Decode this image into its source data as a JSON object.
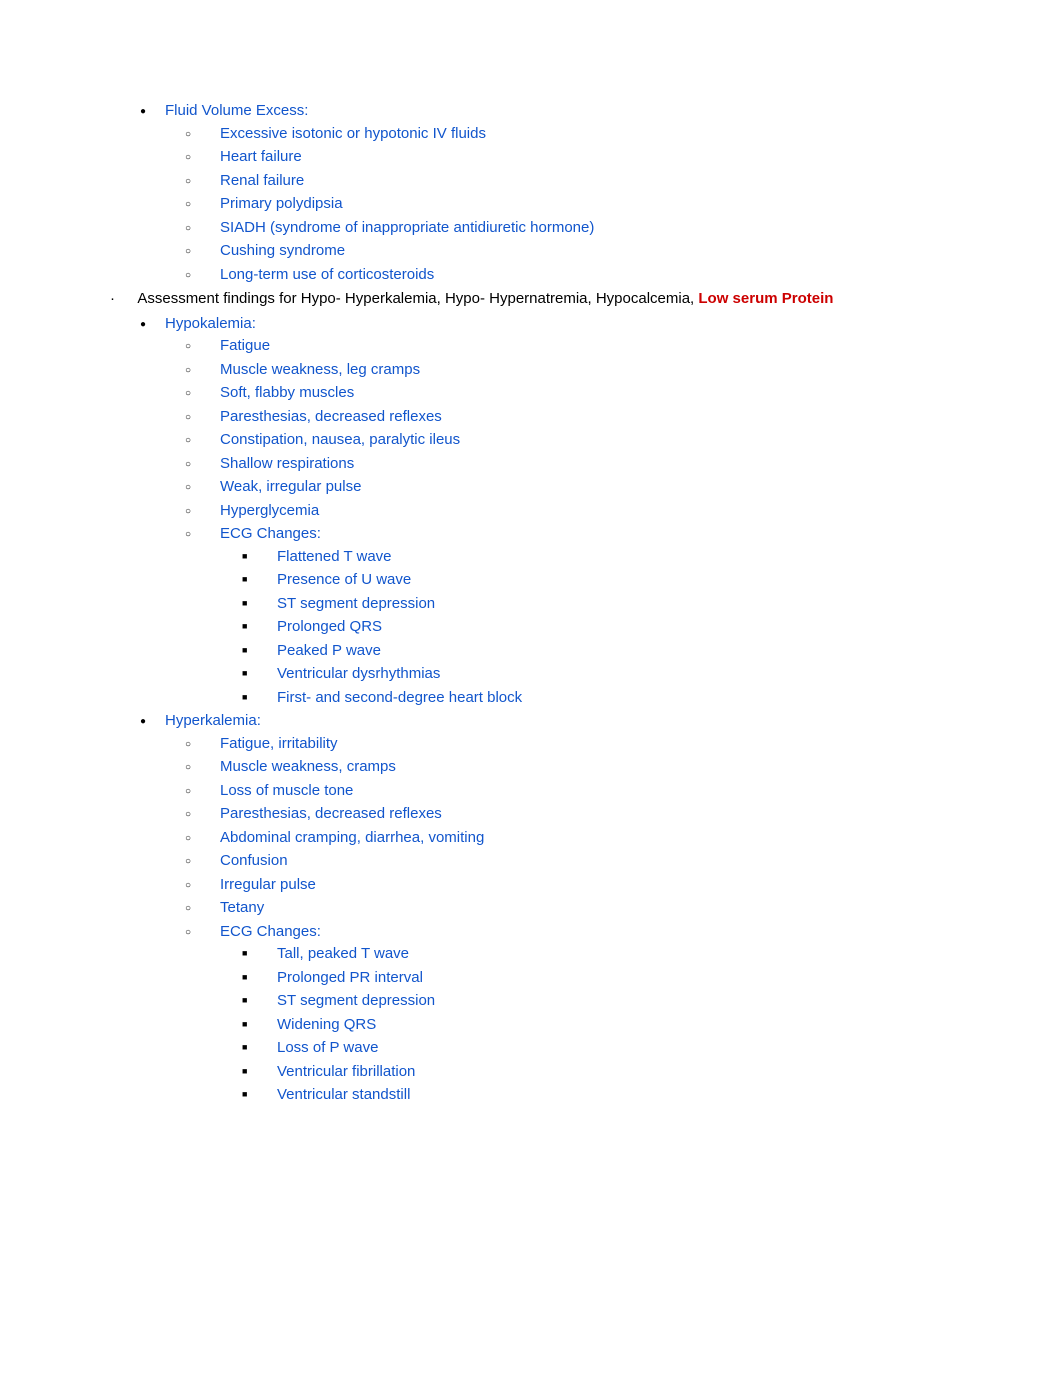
{
  "sections": {
    "fluid_volume_excess": {
      "title": "Fluid Volume Excess:",
      "items": [
        "Excessive isotonic or hypotonic IV fluids",
        "Heart failure",
        "Renal failure",
        "Primary polydipsia",
        "SIADH (syndrome of inappropriate antidiuretic hormone)",
        "Cushing syndrome",
        "Long-term use of corticosteroids"
      ]
    },
    "assessment_header": {
      "prefix": "·",
      "black_text": "Assessment findings for Hypo- Hyperkalemia, Hypo- Hypernatremia, Hypocalcemia, ",
      "red_text": "Low serum Protein"
    },
    "hypokalemia": {
      "title": "Hypokalemia:",
      "items": [
        "Fatigue",
        "Muscle weakness, leg cramps",
        "Soft, flabby muscles",
        "Paresthesias, decreased reflexes",
        "Constipation, nausea, paralytic ileus",
        "Shallow respirations",
        "Weak, irregular pulse",
        "Hyperglycemia"
      ],
      "ecg_title": "ECG Changes:",
      "ecg_items": [
        "Flattened T wave",
        "Presence of U wave",
        "ST segment depression",
        "Prolonged QRS",
        "Peaked P wave",
        "Ventricular dysrhythmias",
        "First- and second-degree heart block"
      ]
    },
    "hyperkalemia": {
      "title": "Hyperkalemia:",
      "items": [
        "Fatigue, irritability",
        "Muscle weakness, cramps",
        "Loss of muscle tone",
        "Paresthesias, decreased reflexes",
        "Abdominal cramping, diarrhea, vomiting",
        "Confusion",
        "Irregular pulse",
        "Tetany"
      ],
      "ecg_title": "ECG Changes:",
      "ecg_items": [
        "Tall, peaked T wave",
        "Prolonged PR interval",
        "ST segment depression",
        "Widening QRS",
        "Loss of P wave",
        "Ventricular fibrillation",
        "Ventricular standstill"
      ]
    }
  }
}
